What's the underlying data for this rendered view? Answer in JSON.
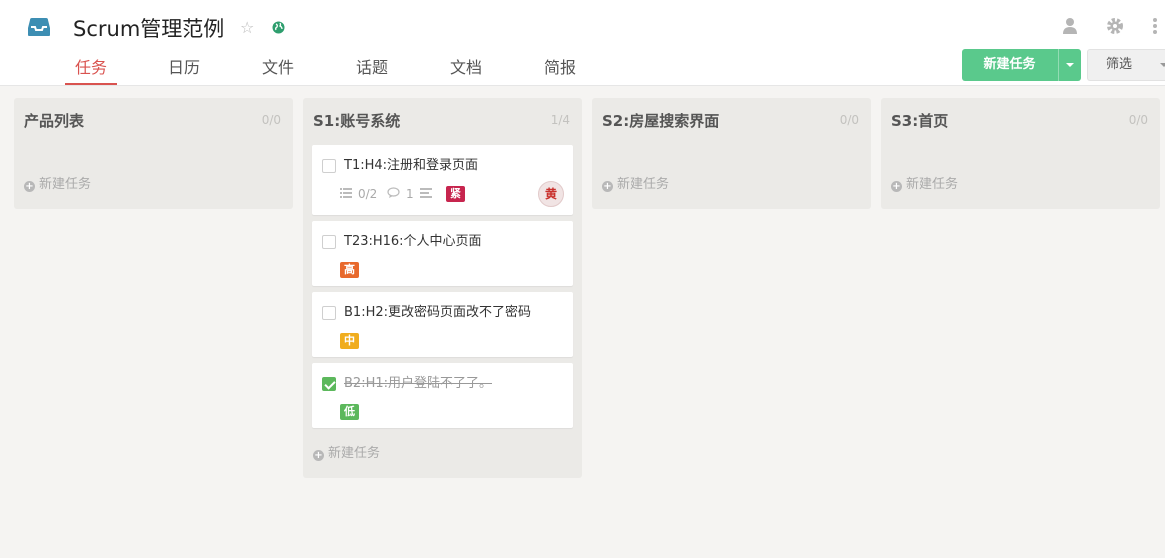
{
  "header": {
    "project_title": "Scrum管理范例",
    "star_glyph": "☆"
  },
  "tabs": [
    {
      "label": "任务",
      "active": true
    },
    {
      "label": "日历",
      "active": false
    },
    {
      "label": "文件",
      "active": false
    },
    {
      "label": "话题",
      "active": false
    },
    {
      "label": "文档",
      "active": false
    },
    {
      "label": "简报",
      "active": false
    }
  ],
  "toolbar": {
    "new_task_label": "新建任务",
    "filter_label": "筛选"
  },
  "columns": [
    {
      "title": "产品列表",
      "count": "0/0",
      "add_label": "新建任务"
    },
    {
      "title": "S1:账号系统",
      "count": "1/4",
      "add_label": "新建任务"
    },
    {
      "title": "S2:房屋搜索界面",
      "count": "0/0",
      "add_label": "新建任务"
    },
    {
      "title": "S3:首页",
      "count": "0/0",
      "add_label": "新建任务"
    }
  ],
  "cards": [
    {
      "title": "T1:H4:注册和登录页面",
      "done": false,
      "subtasks": "0/2",
      "comments": "1",
      "priority": "紧急",
      "priority_color": "#c7254e",
      "assignee": "黄"
    },
    {
      "title": "T23:H16:个人中心页面",
      "done": false,
      "priority": "高",
      "priority_color": "#e8692c"
    },
    {
      "title": "B1:H2:更改密码页面改不了密码",
      "done": false,
      "priority": "中",
      "priority_color": "#f0ad1e"
    },
    {
      "title": "B2:H1:用户登陆不了了。",
      "done": true,
      "priority": "低",
      "priority_color": "#5cb85c"
    }
  ],
  "colors": {
    "accent": "#d9534f",
    "primary_button": "#5ac98c",
    "brand_icon": "#3d8eb3"
  }
}
